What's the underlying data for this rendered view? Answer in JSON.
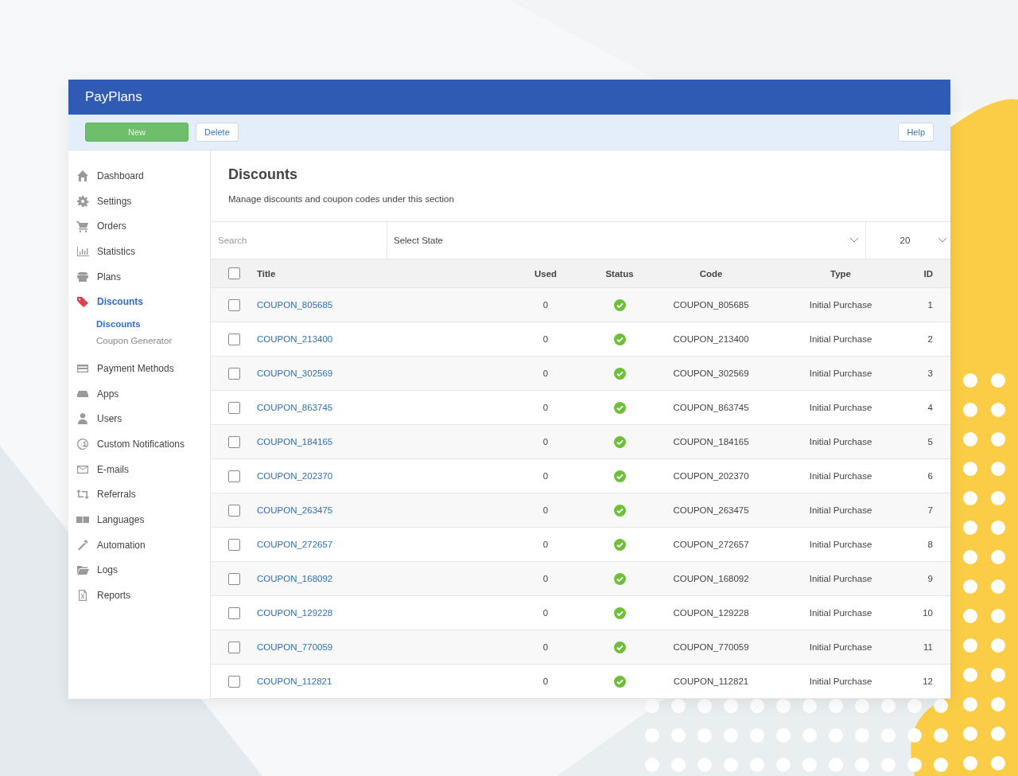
{
  "app": {
    "title": "PayPlans"
  },
  "toolbar": {
    "buttons": [
      {
        "label": "New",
        "kind": "primary"
      },
      {
        "label": "Delete",
        "kind": "default"
      }
    ],
    "help": "Help"
  },
  "sidebar": {
    "items": [
      {
        "label": "Dashboard",
        "selected": false
      },
      {
        "label": "Settings",
        "selected": false
      },
      {
        "label": "Orders",
        "selected": false
      },
      {
        "label": "Statistics",
        "selected": false
      },
      {
        "label": "Plans",
        "selected": false
      },
      {
        "label": "Discounts",
        "selected": true,
        "expanded": true,
        "children": [
          {
            "label": "Discounts",
            "selected": true
          },
          {
            "label": "Coupon Generator",
            "selected": false
          }
        ]
      },
      {
        "label": "Payment Methods",
        "selected": false
      },
      {
        "label": "Apps",
        "selected": false
      },
      {
        "label": "Users",
        "selected": false
      },
      {
        "label": "Custom Notifications",
        "selected": false
      },
      {
        "label": "E-mails",
        "selected": false
      },
      {
        "label": "Referrals",
        "selected": false
      },
      {
        "label": "Languages",
        "selected": false
      },
      {
        "label": "Automation",
        "selected": false
      },
      {
        "label": "Logs",
        "selected": false
      },
      {
        "label": "Reports",
        "selected": false
      }
    ]
  },
  "page": {
    "title": "Discounts",
    "description": "Manage discounts and coupon codes under this section"
  },
  "filters": {
    "search": {
      "placeholder": "Search"
    },
    "state": {
      "value": "Select State"
    },
    "per_page": {
      "value": "20"
    }
  },
  "table": {
    "columns": [
      "Title",
      "Used",
      "Status",
      "Code",
      "Type",
      "ID"
    ],
    "all_checked": false,
    "rows": [
      {
        "title": "COUPON_805685",
        "used": "0",
        "published": true,
        "code": "COUPON_805685",
        "type": "Initial Purchase",
        "id": "1",
        "checked": false
      },
      {
        "title": "COUPON_213400",
        "used": "0",
        "published": true,
        "code": "COUPON_213400",
        "type": "Initial Purchase",
        "id": "2",
        "checked": false
      },
      {
        "title": "COUPON_302569",
        "used": "0",
        "published": true,
        "code": "COUPON_302569",
        "type": "Initial Purchase",
        "id": "3",
        "checked": false
      },
      {
        "title": "COUPON_863745",
        "used": "0",
        "published": true,
        "code": "COUPON_863745",
        "type": "Initial Purchase",
        "id": "4",
        "checked": false
      },
      {
        "title": "COUPON_184165",
        "used": "0",
        "published": true,
        "code": "COUPON_184165",
        "type": "Initial Purchase",
        "id": "5",
        "checked": false
      },
      {
        "title": "COUPON_202370",
        "used": "0",
        "published": true,
        "code": "COUPON_202370",
        "type": "Initial Purchase",
        "id": "6",
        "checked": false
      },
      {
        "title": "COUPON_263475",
        "used": "0",
        "published": true,
        "code": "COUPON_263475",
        "type": "Initial Purchase",
        "id": "7",
        "checked": false
      },
      {
        "title": "COUPON_272657",
        "used": "0",
        "published": true,
        "code": "COUPON_272657",
        "type": "Initial Purchase",
        "id": "8",
        "checked": false
      },
      {
        "title": "COUPON_168092",
        "used": "0",
        "published": true,
        "code": "COUPON_168092",
        "type": "Initial Purchase",
        "id": "9",
        "checked": false
      },
      {
        "title": "COUPON_129228",
        "used": "0",
        "published": true,
        "code": "COUPON_129228",
        "type": "Initial Purchase",
        "id": "10",
        "checked": false
      },
      {
        "title": "COUPON_770059",
        "used": "0",
        "published": true,
        "code": "COUPON_770059",
        "type": "Initial Purchase",
        "id": "11",
        "checked": false
      },
      {
        "title": "COUPON_112821",
        "used": "0",
        "published": true,
        "code": "COUPON_112821",
        "type": "Initial Purchase",
        "id": "12",
        "checked": false
      }
    ]
  }
}
